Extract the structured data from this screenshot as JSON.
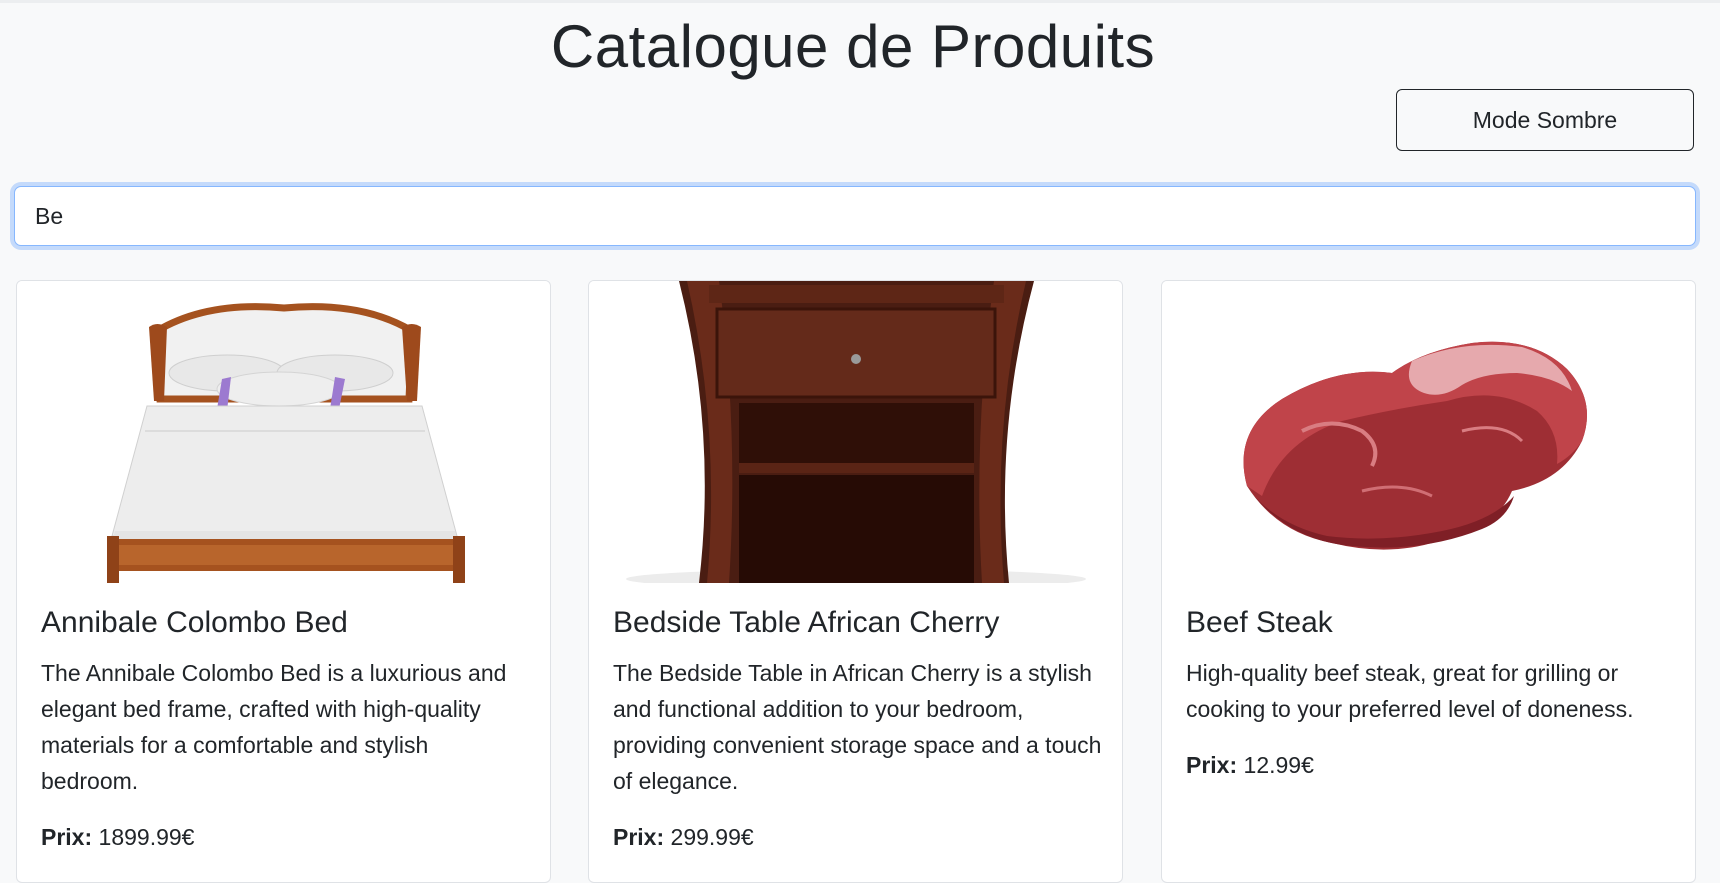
{
  "page": {
    "title": "Catalogue de Produits"
  },
  "toolbar": {
    "mode_label": "Mode Sombre"
  },
  "search": {
    "value": "Be",
    "placeholder": ""
  },
  "products": [
    {
      "name": "Annibale Colombo Bed",
      "description": "The Annibale Colombo Bed is a luxurious and elegant bed frame, crafted with high-quality materials for a comfortable and stylish bedroom.",
      "price_label": "Prix:",
      "price": "1899.99€",
      "image": "bed-image"
    },
    {
      "name": "Bedside Table African Cherry",
      "description": "The Bedside Table in African Cherry is a stylish and functional addition to your bedroom, providing convenient storage space and a touch of elegance.",
      "price_label": "Prix:",
      "price": "299.99€",
      "image": "bedside-table-image"
    },
    {
      "name": "Beef Steak",
      "description": "High-quality beef steak, great for grilling or cooking to your preferred level of doneness.",
      "price_label": "Prix:",
      "price": "12.99€",
      "image": "beef-steak-image"
    }
  ],
  "colors": {
    "background": "#f8f9fa",
    "focus_border": "#86b7fe",
    "text": "#212529"
  }
}
